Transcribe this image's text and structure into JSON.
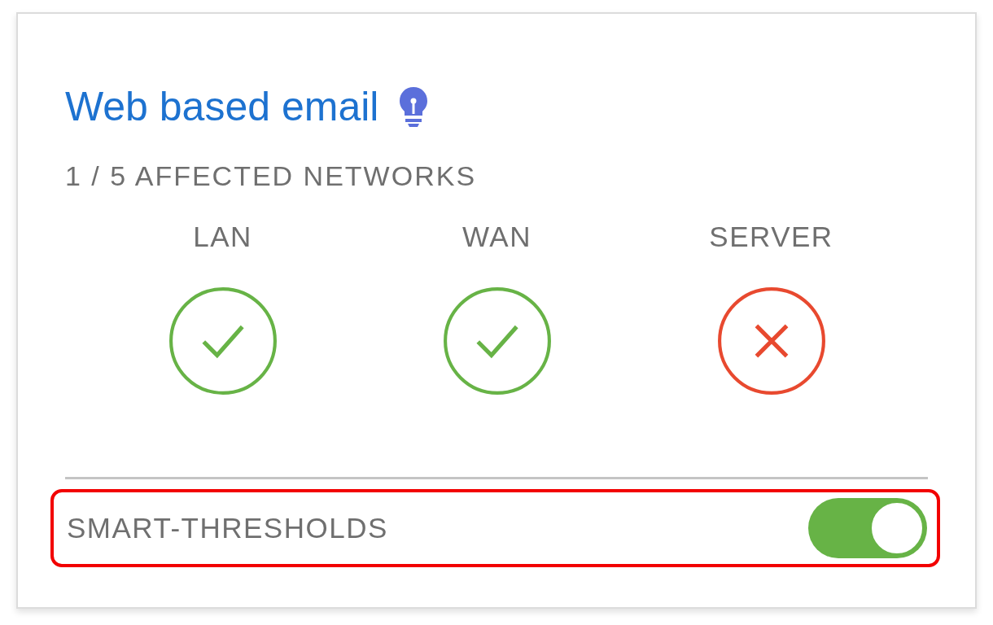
{
  "card": {
    "title": "Web based email",
    "affected": "1 / 5 AFFECTED NETWORKS",
    "networks": [
      {
        "label": "LAN",
        "kind": "ok"
      },
      {
        "label": "WAN",
        "kind": "ok"
      },
      {
        "label": "SERVER",
        "kind": "fail"
      }
    ],
    "setting": {
      "label": "SMART-THRESHOLDS",
      "on": true,
      "highlighted": true
    }
  }
}
